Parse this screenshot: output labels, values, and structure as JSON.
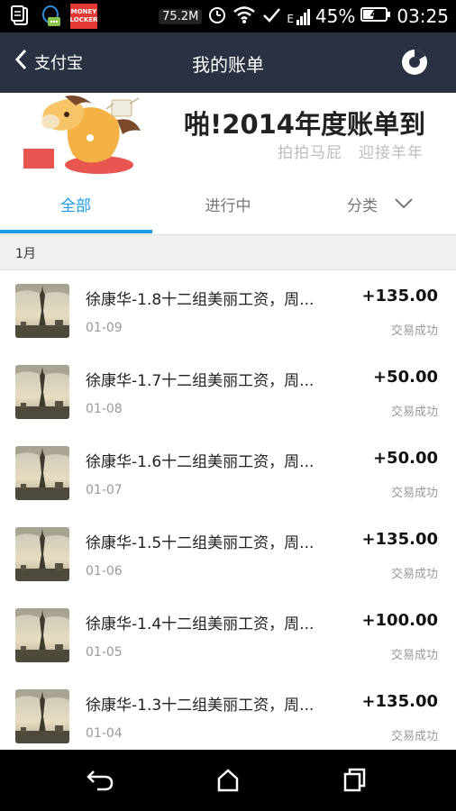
{
  "status_bar": {
    "speed": "75.2M",
    "network": "E",
    "battery": "45%",
    "time": "03:25",
    "money_locker": "MONEY LOCKER",
    "icons": [
      "document-icon",
      "qq-icon",
      "money-locker-icon",
      "wifi-icon",
      "alarm-icon",
      "wifi-icon",
      "check-icon",
      "signal-icon",
      "battery-icon"
    ]
  },
  "nav": {
    "back_label": "支付宝",
    "title": "我的账单",
    "chart_icon": "pie-chart-icon"
  },
  "banner": {
    "title": "啪!2014年度账单到",
    "subtitle": "拍拍马屁　迎接羊年"
  },
  "tabs": [
    {
      "label": "全部",
      "active": true
    },
    {
      "label": "进行中",
      "active": false
    },
    {
      "label": "分类",
      "active": false,
      "icon": "chevron-down-icon"
    }
  ],
  "month_header": "1月",
  "transactions": [
    {
      "title": "徐康华-1.8十二组美丽工资，周...",
      "date": "01-09",
      "amount": "+135.00",
      "status": "交易成功"
    },
    {
      "title": "徐康华-1.7十二组美丽工资，周...",
      "date": "01-08",
      "amount": "+50.00",
      "status": "交易成功"
    },
    {
      "title": "徐康华-1.6十二组美丽工资，周...",
      "date": "01-07",
      "amount": "+50.00",
      "status": "交易成功"
    },
    {
      "title": "徐康华-1.5十二组美丽工资，周...",
      "date": "01-06",
      "amount": "+135.00",
      "status": "交易成功"
    },
    {
      "title": "徐康华-1.4十二组美丽工资，周...",
      "date": "01-05",
      "amount": "+100.00",
      "status": "交易成功"
    },
    {
      "title": "徐康华-1.3十二组美丽工资，周...",
      "date": "01-04",
      "amount": "+135.00",
      "status": "交易成功"
    }
  ],
  "system_nav": [
    "back-icon",
    "home-icon",
    "recent-apps-icon"
  ],
  "colors": {
    "accent": "#1a9be4",
    "navbar": "#2a3140"
  }
}
